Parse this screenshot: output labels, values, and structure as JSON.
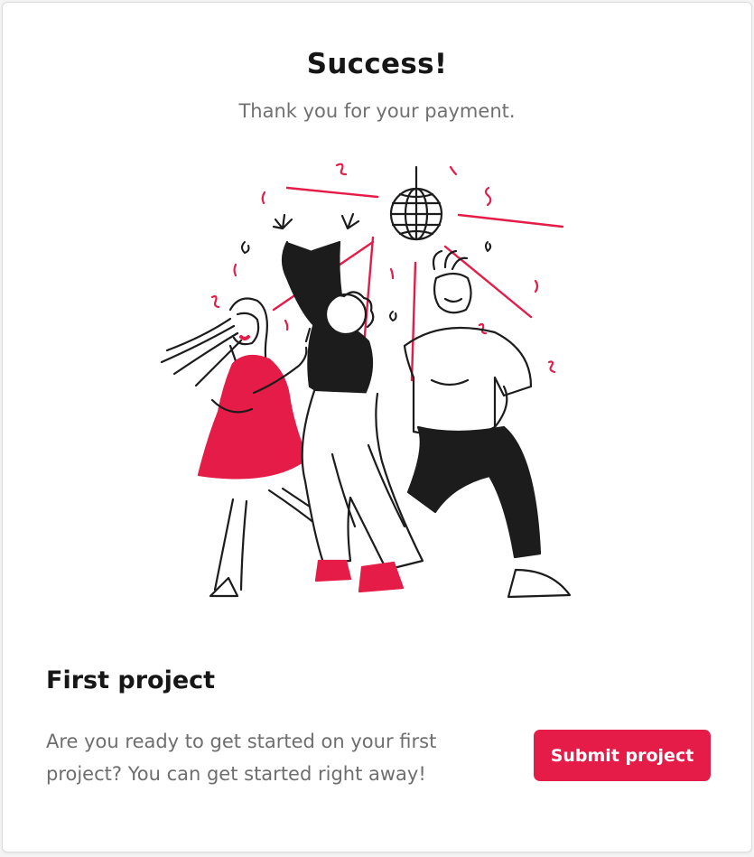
{
  "header": {
    "title": "Success!",
    "subtitle": "Thank you for your payment."
  },
  "illustration": {
    "icon": "dancing-party-illustration"
  },
  "project": {
    "heading": "First project",
    "description": "Are you ready to get started on your first project? You can get started right away!",
    "submit_label": "Submit project"
  },
  "colors": {
    "accent": "#e51c47",
    "heading": "#161616",
    "body_text": "#707070",
    "ink": "#1c1c1c"
  }
}
